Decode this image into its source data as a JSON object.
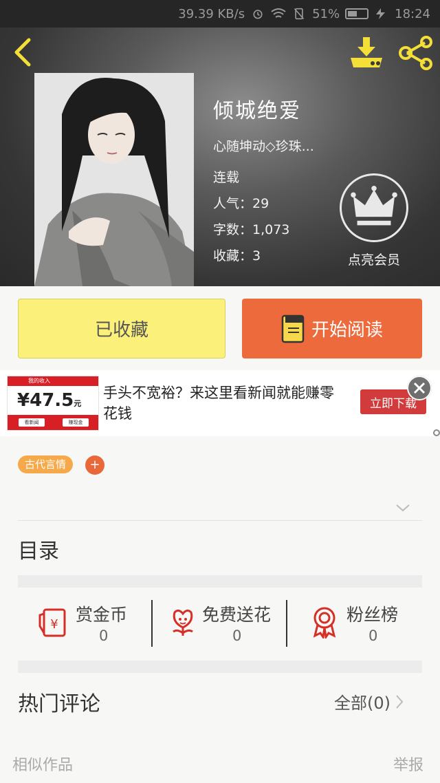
{
  "status_bar": {
    "speed": "39.39 KB/s",
    "battery": "51%",
    "battery_level": 0.51,
    "time": "18:24"
  },
  "book": {
    "title": "倾城绝爱",
    "author": "心随坤动◇珍珠...",
    "status": "连载",
    "popularity": "人气：29",
    "word_count": "字数：1,073",
    "favorites": "收藏：3"
  },
  "vip": {
    "label": "点亮会员"
  },
  "actions": {
    "collected_label": "已收藏",
    "read_label": "开始阅读"
  },
  "ad": {
    "banner_line": "我的收入",
    "amount": "¥47.5",
    "amount_unit": "元",
    "chip_left": "看新闻",
    "chip_right": "赚现金",
    "text": "手头不宽裕？来这里看新闻就能赚零花钱",
    "cta": "立即下载"
  },
  "tags": [
    "古代言情"
  ],
  "tag_add": "+",
  "toc_label": "目录",
  "stats": [
    {
      "label": "赏金币",
      "value": "0",
      "icon": "red-packet-icon"
    },
    {
      "label": "免费送花",
      "value": "0",
      "icon": "flower-icon"
    },
    {
      "label": "粉丝榜",
      "value": "0",
      "icon": "medal-icon"
    }
  ],
  "comments": {
    "title": "热门评论",
    "all_label": "全部(0)"
  },
  "footer": {
    "similar": "相似作品",
    "report": "举报"
  },
  "colors": {
    "accent_yellow": "#fbf07a",
    "accent_orange": "#ec6a3b",
    "icon_yellow": "#f3df38",
    "icon_red": "#d52f27"
  }
}
